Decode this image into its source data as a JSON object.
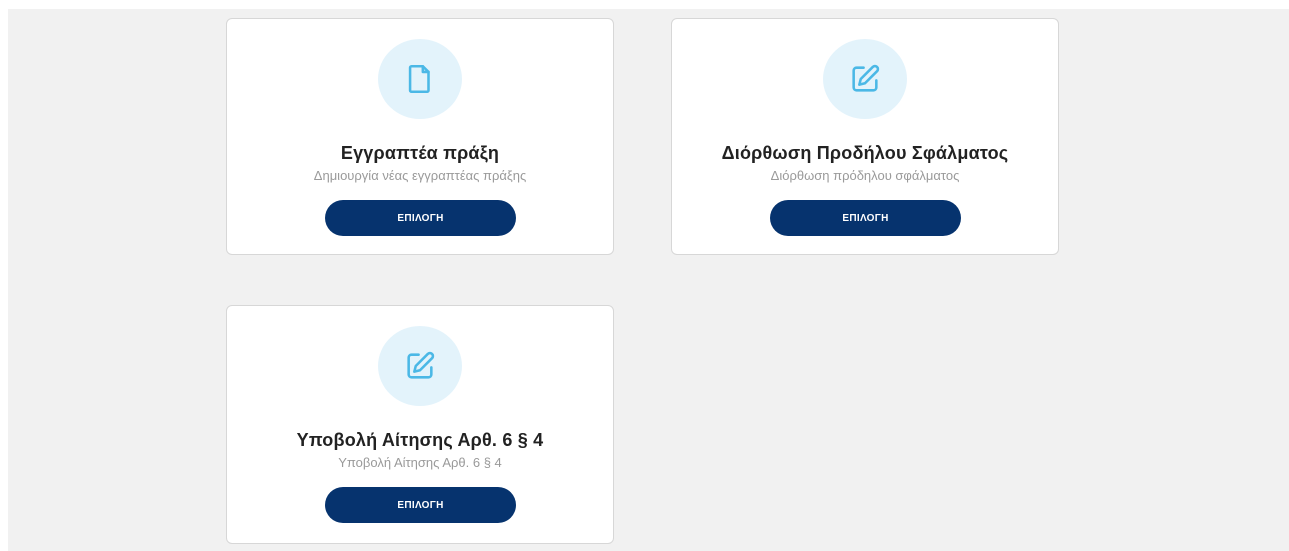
{
  "colors": {
    "background": "#f1f1f1",
    "card": "#ffffff",
    "icon_circle": "#e3f3fb",
    "icon_stroke": "#4bb8e6",
    "button": "#06336e",
    "button_text": "#ffffff",
    "title": "#222222",
    "subtitle": "#9a9a9a"
  },
  "cards": [
    {
      "icon": "document-icon",
      "title": "Εγγραπτέα πράξη",
      "subtitle": "Δημιουργία νέας εγγραπτέας πράξης",
      "button_label": "ΕΠΙΛΟΓΗ"
    },
    {
      "icon": "edit-icon",
      "title": "Διόρθωση Προδήλου Σφάλματος",
      "subtitle": "Διόρθωση πρόδηλου σφάλματος",
      "button_label": "ΕΠΙΛΟΓΗ"
    },
    {
      "icon": "edit-icon",
      "title": "Υποβολή Αίτησης Αρθ. 6 § 4",
      "subtitle": "Υποβολή Αίτησης Αρθ. 6 § 4",
      "button_label": "ΕΠΙΛΟΓΗ"
    }
  ]
}
